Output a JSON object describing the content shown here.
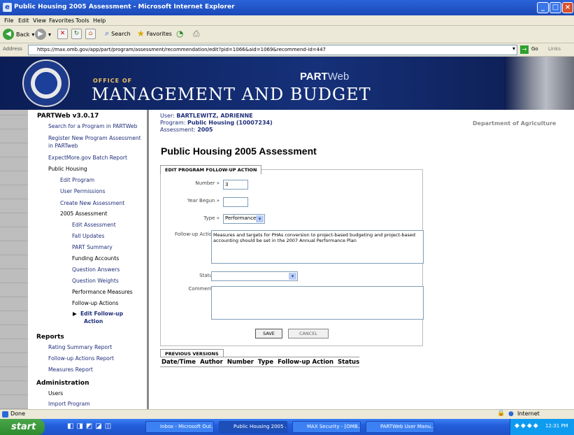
{
  "window": {
    "title": "Public Housing 2005 Assessment - Microsoft Internet Explorer",
    "minimize": "_",
    "maximize": "□",
    "close": "×"
  },
  "menu": [
    "File",
    "Edit",
    "View",
    "Favorites",
    "Tools",
    "Help"
  ],
  "toolbar": {
    "back": "Back",
    "search": "Search",
    "favorites": "Favorites"
  },
  "address": {
    "label": "Address",
    "url": "https://max.omb.gov/app/part/program/assessment/recommendation/edit?pid=1066&aid=1069&recommend-id=447",
    "go": "Go",
    "links": "Links"
  },
  "banner": {
    "office_of": "OFFICE OF",
    "agency": "MANAGEMENT AND BUDGET",
    "app_part": "PART",
    "app_web": "Web"
  },
  "nav": {
    "version": "PARTWeb v3.0.17",
    "links": {
      "search": "Search for a Program in PARTWeb",
      "register_1": "Register New Program Assessment",
      "register_2": "in PARTweb",
      "expectmore": "ExpectMore.gov Batch Report",
      "public_housing": "Public Housing",
      "edit_program": "Edit Program",
      "user_permissions": "User Permissions",
      "create_assessment": "Create New Assessment",
      "assessment_2005": "2005 Assessment",
      "edit_assessment": "Edit Assessment",
      "fall_updates": "Fall Updates",
      "part_summary": "PART Summary",
      "funding_accounts": "Funding Accounts",
      "question_answers": "Question Answers",
      "question_weights": "Question Weights",
      "performance_measures": "Performance Measures",
      "followup_actions": "Follow-up Actions",
      "edit_followup_1": "Edit Follow-up",
      "edit_followup_2": "Action",
      "reports": "Reports",
      "rating_summary": "Rating Summary Report",
      "followup_report": "Follow-up Actions Report",
      "measures_report": "Measures Report",
      "administration": "Administration",
      "users": "Users",
      "import_program": "Import Program"
    }
  },
  "info": {
    "user_label": "User:",
    "user": "BARTLEWITZ, ADRIENNE",
    "program_label": "Program:",
    "program": "Public Housing (10007234)",
    "assessment_label": "Assessment:",
    "assessment": "2005",
    "department": "Department of Agriculture"
  },
  "page_title": "Public Housing 2005 Assessment",
  "form": {
    "section": "EDIT PROGRAM FOLLOW-UP ACTION",
    "number_label": "Number »",
    "number_value": "3",
    "year_label": "Year Begun »",
    "year_value": "",
    "type_label": "Type »",
    "type_value": "Performance",
    "followup_label": "Follow-up Action »",
    "followup_value": "Measures and targets for PHAs conversion to project-based budgeting and project-based accounting should be set in the 2007 Annual Performance Plan",
    "status_label": "Status »",
    "status_value": "",
    "comments_label": "Comments »",
    "comments_value": "",
    "save": "SAVE",
    "cancel": "CANCEL"
  },
  "previous": {
    "section": "PREVIOUS VERSIONS",
    "columns": [
      "Date/Time",
      "Author",
      "Number",
      "Type",
      "Follow-up Action",
      "Status"
    ]
  },
  "statusbar": {
    "left": "Done",
    "zone": "Internet"
  },
  "taskbar": {
    "start": "start",
    "tasks": [
      "Inbox - Microsoft Out...",
      "Public Housing 2005 ...",
      "MAX Security - [OMB...",
      "PARTWeb User Manu..."
    ],
    "clock": "12:31 PM"
  },
  "colors": {
    "nav_link": "#1f2f7a",
    "banner": "#16317a",
    "titlebar": "#2a63d8",
    "taskbar": "#245edb",
    "start": "#3c9a3c"
  }
}
